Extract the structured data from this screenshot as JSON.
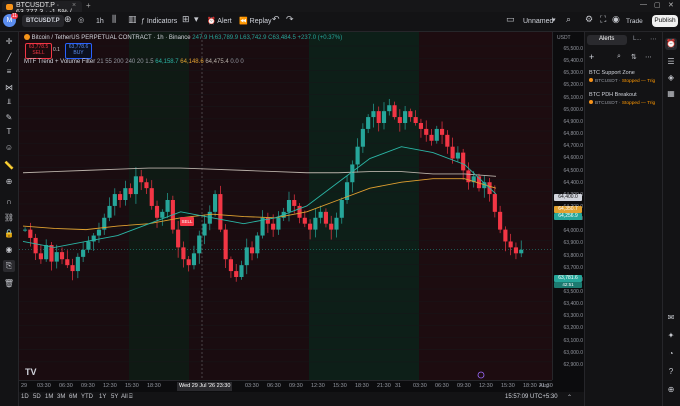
{
  "browser": {
    "tab_title": "BTCUSDT.P · 63,777.3 · -1.5% / ...",
    "new_tab": "+",
    "close_tab": "×"
  },
  "toolbar": {
    "avatar_letter": "M",
    "avatar_badge": "11",
    "symbol": "BTCUSDT.P",
    "interval": "1h",
    "indicators_label": "Indicators",
    "alert_label": "Alert",
    "replay_label": "Replay",
    "layout_name": "Unnamed",
    "trade_label": "Trade",
    "publish_label": "Publish"
  },
  "legend": {
    "symbol_title": "Bitcoin / TetherUS PERPETUAL CONTRACT · 1h · Binance",
    "ohlc": "247.9  H₍63,789.9  L63,742.9  C63,484.5  +237.0 (+0.37%)",
    "sell_price": "63,778.5",
    "sell_label": "SELL",
    "spread": "0.1",
    "buy_price": "63,778.6",
    "buy_label": "BUY",
    "indicator_name": "MTF Trend + Volume Filter",
    "indicator_params": "21 55 200 240 20 1.5",
    "indicator_val1": "64,158.7",
    "indicator_val2": "64,148.6",
    "indicator_val3": "64,475.4",
    "indicator_val4": "0.0",
    "indicator_val5": "0"
  },
  "price_axis": {
    "currency": "USDT",
    "ticks": [
      "65,500.0",
      "65,400.0",
      "65,300.0",
      "65,200.0",
      "65,100.0",
      "65,000.0",
      "64,900.0",
      "64,800.0",
      "64,700.0",
      "64,600.0",
      "64,500.0",
      "64,400.0",
      "64,300.0",
      "64,200.0",
      "64,100.0",
      "64,000.0",
      "63,900.0",
      "63,800.0",
      "63,700.0",
      "63,600.0",
      "63,500.0",
      "63,400.0",
      "63,300.0",
      "63,200.0",
      "63,100.0",
      "63,000.0",
      "62,900.0"
    ],
    "tag_white": "64,400.0",
    "tag_orange": "64,350.7",
    "tag_teal": "64,256.9",
    "tag_last": "63,781.6",
    "tag_last_sub": "42:51"
  },
  "time_axis": {
    "ticks": [
      "29",
      "03:30",
      "06:30",
      "09:30",
      "12:30",
      "15:30",
      "18:30",
      "Wed 29 Jul '26  23:30",
      "03:30",
      "06:30",
      "09:30",
      "12:30",
      "15:30",
      "18:30",
      "21:30",
      "31",
      "03:30",
      "06:30",
      "09:30",
      "12:30",
      "15:30",
      "18:30",
      "21:30",
      "Aug"
    ]
  },
  "bottom": {
    "ranges": [
      "1D",
      "5D",
      "1M",
      "3M",
      "6M",
      "YTD",
      "1Y",
      "5Y",
      "All"
    ],
    "clock": "15:57:09 UTC+5:30"
  },
  "chart_marker": {
    "sell_flag": "SELL"
  },
  "right_panel": {
    "tab_alerts": "Alerts",
    "tab_log": "L...",
    "alerts": [
      {
        "name": "BTC Support Zone",
        "symbol": "BTCUSDT",
        "status": "Stopped — Trig"
      },
      {
        "name": "BTC PDH Breakout",
        "symbol": "BTCUSDT",
        "status": "Stopped — Trig"
      }
    ]
  },
  "colors": {
    "up": "#26a69a",
    "down": "#f23645",
    "ema_fast": "#2bb5a5",
    "ema_mid": "#e0a030",
    "ema_slow": "#b8b0a8",
    "status": "#ff9800"
  },
  "chart_data": {
    "type": "candlestick",
    "x": [
      "29 03:30",
      "29 06:30",
      "29 09:30",
      "29 12:30",
      "29 15:30",
      "29 18:30",
      "29 21:30",
      "30 03:30",
      "30 09:30",
      "30 15:30",
      "30 21:30",
      "31 03:30",
      "31 09:30",
      "31 15:30"
    ],
    "ylim": [
      62900,
      65500
    ],
    "series": [
      {
        "name": "MTF Trend + Volume Filter",
        "values": [
          64480,
          64480,
          64470,
          64460,
          64470,
          64470,
          64450,
          64430,
          64430,
          64440,
          64420,
          64420,
          64380,
          64350
        ]
      }
    ],
    "last_price": 63781.6
  }
}
